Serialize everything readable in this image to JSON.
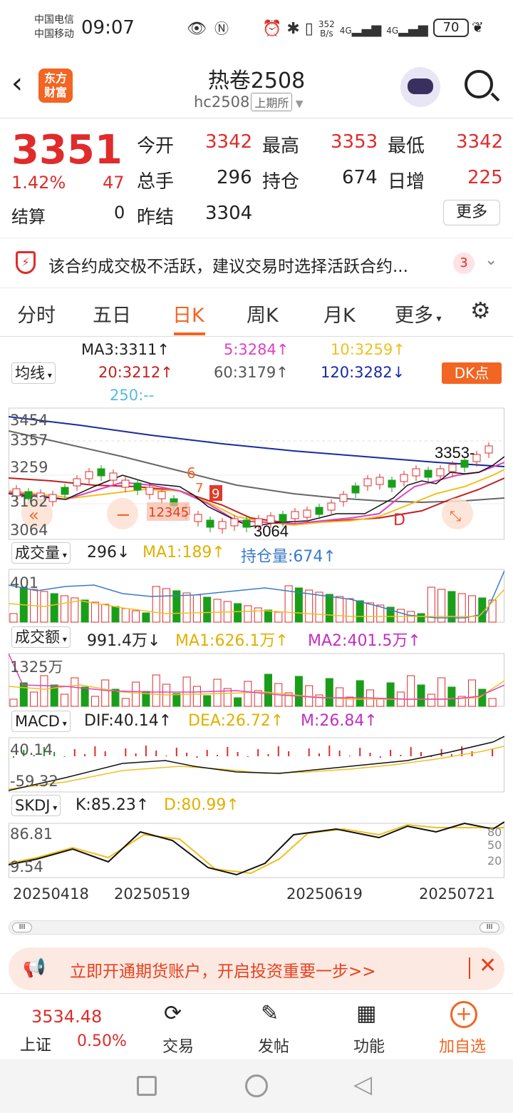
{
  "status": {
    "carrier1": "中国电信",
    "carrier2": "中国移动",
    "time": "09:07",
    "net_speed_value": "352",
    "net_speed_unit": "B/s",
    "net1": "4G",
    "net2": "4G",
    "battery": "70"
  },
  "header": {
    "title": "热卷2508",
    "code": "hc2508",
    "exchange": "上期所"
  },
  "logo": {
    "line1": "东方",
    "line2": "财富"
  },
  "quote": {
    "price": "3351",
    "change_pct": "1.42%",
    "change": "47",
    "settle_label": "结算",
    "settle": "0",
    "open_label": "今开",
    "open": "3342",
    "high_label": "最高",
    "high": "3353",
    "low_label": "最低",
    "low": "3342",
    "volume_label": "总手",
    "volume": "296",
    "oi_label": "持仓",
    "oi": "674",
    "daily_inc_label": "日增",
    "daily_inc": "225",
    "prev_settle_label": "昨结",
    "prev_settle": "3304",
    "more_button": "更多"
  },
  "notice": {
    "text": "该合约成交极不活跃，建议交易时选择活跃合约...",
    "count": "3"
  },
  "tabs": [
    "分时",
    "五日",
    "日K",
    "周K",
    "月K",
    "更多"
  ],
  "active_tab": 2,
  "ma": {
    "selector": "均线",
    "ma3": "MA3:3311↑",
    "ma5": "5:3284↑",
    "ma10": "10:3259↑",
    "ma20": "20:3212↑",
    "ma60": "60:3179↑",
    "ma120": "120:3282↓",
    "ma250": "250:--",
    "dk_button": "DK点"
  },
  "colors": {
    "up": "#e02b2b",
    "down": "#1a9e1a",
    "accent": "#f26522",
    "ma5": "#e040c0",
    "ma10": "#f0c020",
    "ma20": "#c02020",
    "ma60": "#555555",
    "ma120": "#1a2aa0",
    "ma250": "#55bbe0"
  },
  "kchart": {
    "axis": [
      "3454",
      "3357",
      "3259",
      "3162",
      "3064"
    ],
    "last_label": "3353-",
    "low_label": "3064",
    "markers": [
      "6",
      "7",
      "9",
      "12345"
    ],
    "d_marker": "D"
  },
  "volume": {
    "selector": "成交量",
    "value": "296↓",
    "ma1": "MA1:189↑",
    "oi": "持仓量:674↑",
    "axis": "401"
  },
  "turnover": {
    "selector": "成交额",
    "value": "991.4万↓",
    "ma1": "MA1:626.1万↑",
    "ma2": "MA2:401.5万↑",
    "axis": "1325万"
  },
  "macd": {
    "selector": "MACD",
    "dif": "DIF:40.14↑",
    "dea": "DEA:26.72↑",
    "m": "M:26.84↑",
    "axis_top": "40.14",
    "axis_bottom": "-59.32"
  },
  "skdj": {
    "selector": "SKDJ",
    "k": "K:85.23↑",
    "d": "D:80.99↑",
    "axis_top": "86.81",
    "axis_bottom": "9.54",
    "levels": [
      "80",
      "50",
      "20"
    ]
  },
  "dates": [
    "20250418",
    "20250519",
    "20250619",
    "20250721"
  ],
  "banner": {
    "text": "立即开通期货账户，开启投资重要一步>>"
  },
  "bottom": {
    "index_value": "3534.48",
    "index_name": "上证",
    "index_pct": "0.50%",
    "trade": "交易",
    "post": "发帖",
    "function": "功能",
    "add": "加自选"
  }
}
